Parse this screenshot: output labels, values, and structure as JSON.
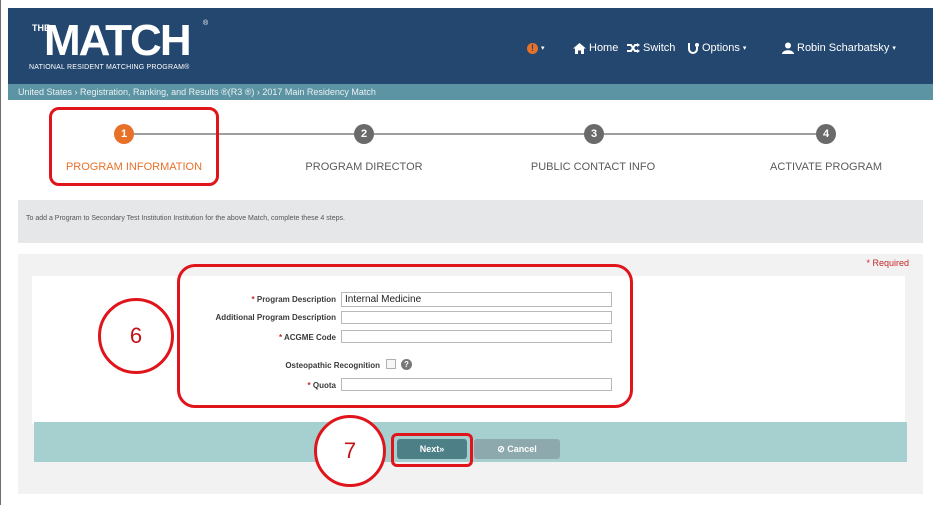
{
  "header": {
    "logo_the": "THE",
    "logo_match": "MATCH",
    "logo_tm": "®",
    "logo_sub": "NATIONAL RESIDENT MATCHING PROGRAM®",
    "nav": {
      "info_caret": "▾",
      "home_label": "Home",
      "switch_label": "Switch",
      "options_label": "Options",
      "options_caret": "▾",
      "user_label": "Robin Scharbatsky",
      "user_caret": "▾"
    },
    "colors": {
      "bar": "#24476f",
      "accent": "#e8712a"
    }
  },
  "breadcrumb": {
    "text": "United States  ›  Registration, Ranking, and Results ®(R3 ®)  ›  2017 Main Residency Match"
  },
  "steps": [
    {
      "number": "1",
      "label": "PROGRAM INFORMATION",
      "active": true
    },
    {
      "number": "2",
      "label": "PROGRAM DIRECTOR",
      "active": false
    },
    {
      "number": "3",
      "label": "PUBLIC CONTACT INFO",
      "active": false
    },
    {
      "number": "4",
      "label": "ACTIVATE PROGRAM",
      "active": false
    }
  ],
  "info_text": "To add a Program to Secondary Test Institution Institution for the above Match, complete these 4 steps.",
  "required_note": "* Required",
  "form": {
    "program_description": {
      "required_mark": "* ",
      "label": "Program Description",
      "value": "Internal Medicine"
    },
    "additional_description": {
      "label": "Additional Program Description",
      "value": ""
    },
    "acgme_code": {
      "required_mark": "* ",
      "label": "ACGME Code",
      "value": ""
    },
    "osteopathic": {
      "label": "Osteopathic Recognition",
      "checked": false,
      "help_icon": "?"
    },
    "quota": {
      "required_mark": "* ",
      "label": "Quota",
      "value": ""
    }
  },
  "buttons": {
    "next_label": "Next»",
    "cancel_label": "Cancel"
  },
  "annotations": {
    "circle_6": "6",
    "circle_7": "7",
    "color": "#e0151b"
  }
}
